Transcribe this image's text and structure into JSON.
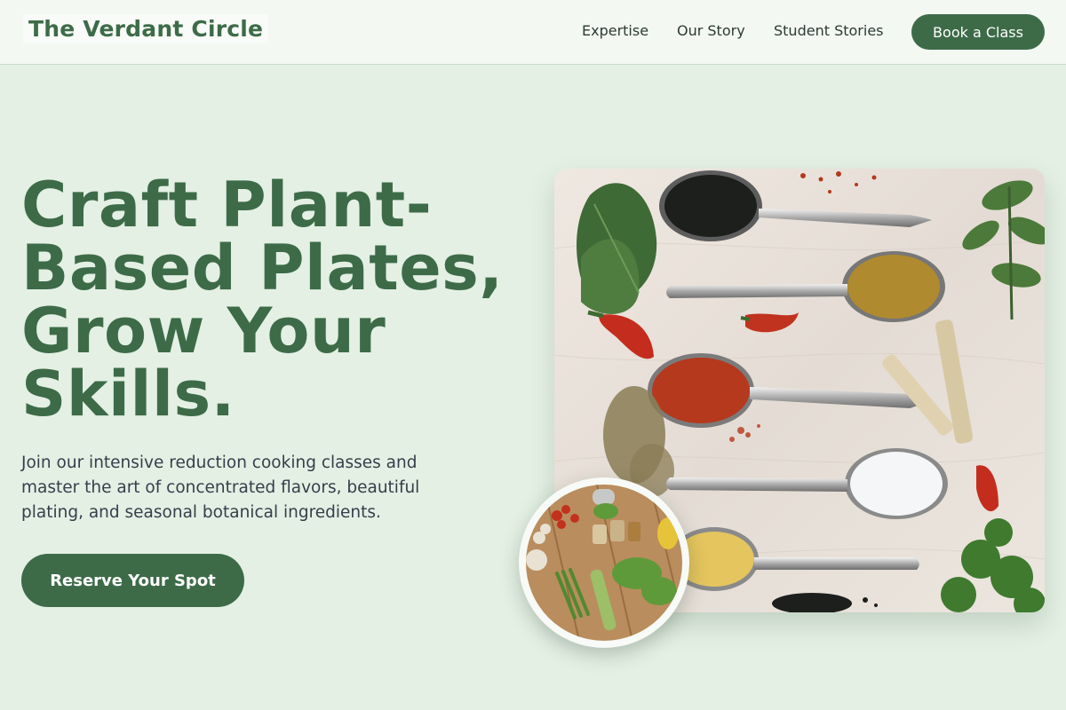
{
  "nav": {
    "brand": "The Verdant Circle",
    "links": [
      "Expertise",
      "Our Story",
      "Student Stories"
    ],
    "cta": "Book a Class"
  },
  "hero": {
    "headline_lines": [
      "Craft Plant-",
      "Based Plates,",
      "Grow Your",
      "Skills."
    ],
    "subtext": "Join our intensive reduction cooking classes and master the art of concentrated flavors, beautiful plating, and seasonal botanical ingredients.",
    "cta": "Reserve Your Spot"
  },
  "images": {
    "main": "spice-spoons-photo",
    "inset": "vegetables-ingredients-photo"
  },
  "colors": {
    "brand_green": "#3d6b48",
    "page_background": "#e4f0e4",
    "nav_background": "#f3f8f3",
    "body_text": "#34404a"
  }
}
